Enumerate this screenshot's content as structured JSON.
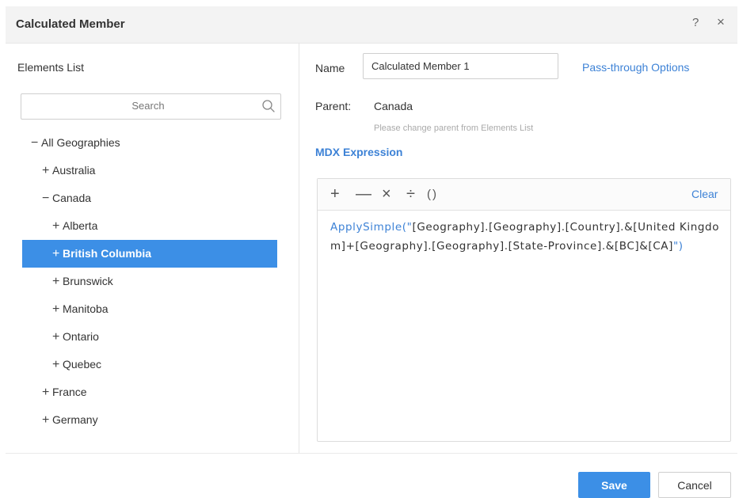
{
  "dialog": {
    "title": "Calculated Member",
    "help_glyph": "?",
    "close_glyph": "×"
  },
  "elements_list": {
    "title": "Elements List",
    "search_placeholder": "Search",
    "search_icon": "search-icon",
    "items": [
      {
        "toggle": "−",
        "label": "All Geographies",
        "level": 0
      },
      {
        "toggle": "+",
        "label": "Australia",
        "level": 1
      },
      {
        "toggle": "−",
        "label": "Canada",
        "level": 1
      },
      {
        "toggle": "+",
        "label": "Alberta",
        "level": 2
      },
      {
        "toggle": "+",
        "label": "British Columbia",
        "level": 2,
        "selected": true
      },
      {
        "toggle": "+",
        "label": "Brunswick",
        "level": 2
      },
      {
        "toggle": "+",
        "label": "Manitoba",
        "level": 2
      },
      {
        "toggle": "+",
        "label": "Ontario",
        "level": 2
      },
      {
        "toggle": "+",
        "label": "Quebec",
        "level": 2
      },
      {
        "toggle": "+",
        "label": "France",
        "level": 1
      },
      {
        "toggle": "+",
        "label": "Germany",
        "level": 1
      }
    ]
  },
  "form": {
    "name_label": "Name",
    "name_value": "Calculated Member 1",
    "pass_through_label": "Pass-through Options",
    "parent_label": "Parent:",
    "parent_value": "Canada",
    "parent_hint": "Please change parent from Elements List",
    "mdx_title": "MDX Expression"
  },
  "expression": {
    "operators": {
      "plus": "+",
      "minus": "—",
      "times": "×",
      "divide": "÷",
      "parens": "()"
    },
    "clear_label": "Clear",
    "function_open": "ApplySimple(\"",
    "body": "[Geography].[Geography].[Country].&[United Kingdom]+[Geography].[Geography].[State-Province].&[BC]&[CA]",
    "function_close": "\")"
  },
  "footer": {
    "save_label": "Save",
    "cancel_label": "Cancel"
  },
  "colors": {
    "accent": "#3c8fe6",
    "link": "#3d82d6",
    "header_bg": "#f3f3f3"
  }
}
